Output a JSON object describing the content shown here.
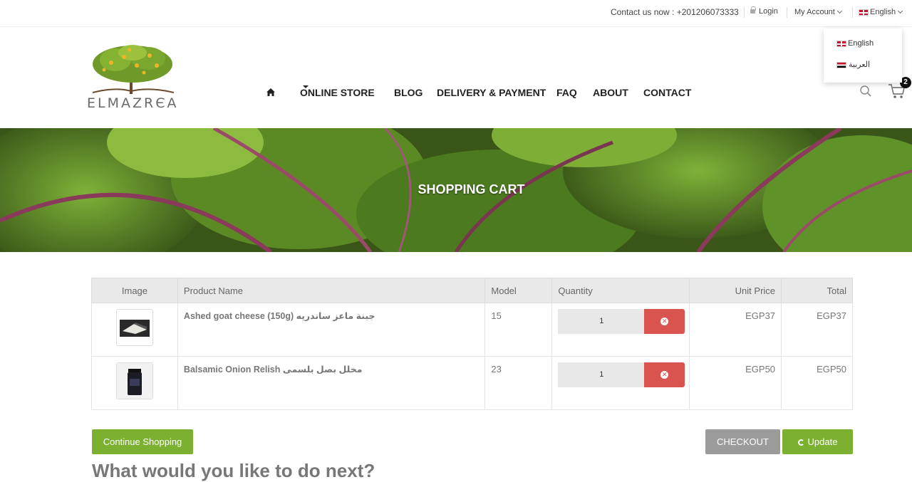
{
  "topbar": {
    "contact": "Contact us now : +201206073333",
    "login": "Login",
    "my_account": "My Account",
    "language": "English"
  },
  "language_menu": {
    "options": [
      "English",
      "العربية"
    ]
  },
  "logo": {
    "text": "ELMAZRЄA"
  },
  "nav": {
    "items": [
      "ONLINE STORE",
      "BLOG",
      "DELIVERY & PAYMENT",
      "FAQ",
      "ABOUT",
      "CONTACT"
    ]
  },
  "cart": {
    "count": "2"
  },
  "banner": {
    "title": "SHOPPING CART"
  },
  "table": {
    "headers": [
      "Image",
      "Product Name",
      "Model",
      "Quantity",
      "Unit Price",
      "Total"
    ],
    "rows": [
      {
        "name": "Ashed goat cheese (150g) جبنة ماعز ساندريه",
        "model": "15",
        "quantity": "1",
        "unit_price": "EGP37",
        "total": "EGP37"
      },
      {
        "name": "Balsamic Onion Relish مخلل بصل بلسمى",
        "model": "23",
        "quantity": "1",
        "unit_price": "EGP50",
        "total": "EGP50"
      }
    ]
  },
  "buttons": {
    "continue": "Continue Shopping",
    "checkout": "CHECKOUT",
    "update": "Update"
  },
  "next_heading": "What would you like to do next?",
  "colors": {
    "accent_green": "#7cb031",
    "remove_red": "#d9534f",
    "checkout_gray": "#9b9b9b"
  }
}
